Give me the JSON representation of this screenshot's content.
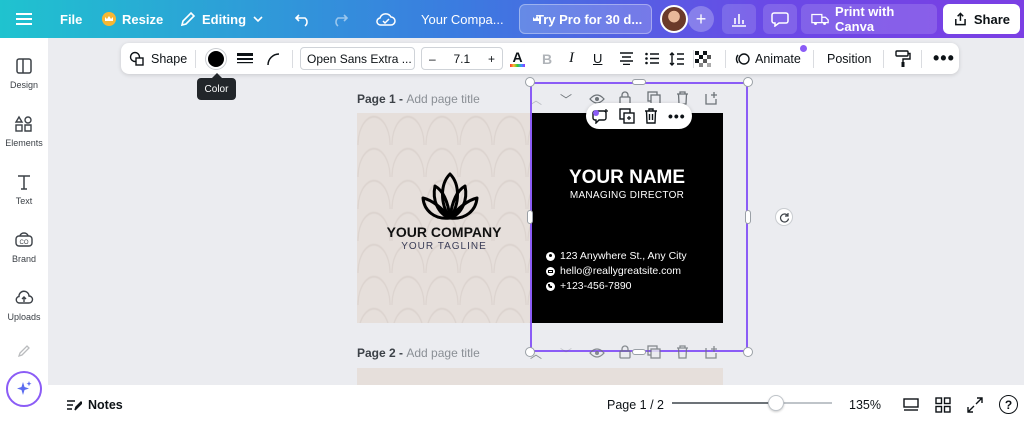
{
  "topbar": {
    "file_label": "File",
    "resize_label": "Resize",
    "editing_label": "Editing",
    "doc_title": "Your Compa...",
    "trial_label": "Try Pro for 30 d...",
    "print_label": "Print with Canva",
    "share_label": "Share"
  },
  "sidebar": {
    "items": [
      {
        "label": "Design",
        "icon": "design-icon"
      },
      {
        "label": "Elements",
        "icon": "elements-icon"
      },
      {
        "label": "Text",
        "icon": "text-icon"
      },
      {
        "label": "Brand",
        "icon": "brand-icon"
      },
      {
        "label": "Uploads",
        "icon": "uploads-icon"
      }
    ]
  },
  "toolbar": {
    "shape_label": "Shape",
    "font_name": "Open Sans Extra ...",
    "font_size": "7.1",
    "animate_label": "Animate",
    "position_label": "Position",
    "color_tooltip": "Color",
    "color_swatch": "#000000"
  },
  "canvas": {
    "page1_label": "Page 1 -",
    "page1_title_placeholder": "Add page title",
    "page2_label": "Page 2 -",
    "page2_title_placeholder": "Add page title",
    "card_front": {
      "company": "YOUR COMPANY",
      "tagline": "YOUR TAGLINE"
    },
    "card_back": {
      "name": "YOUR NAME",
      "role": "MANAGING DIRECTOR",
      "address": "123 Anywhere St., Any City",
      "email": "hello@reallygreatsite.com",
      "phone": "+123-456-7890"
    }
  },
  "bottombar": {
    "notes_label": "Notes",
    "page_indicator": "Page 1 / 2",
    "zoom": "135%",
    "zoom_fraction": 0.65
  },
  "colors": {
    "accent": "#8b5cf6",
    "card_back_bg": "#000000",
    "card_front_bg": "#e6dfdb"
  }
}
